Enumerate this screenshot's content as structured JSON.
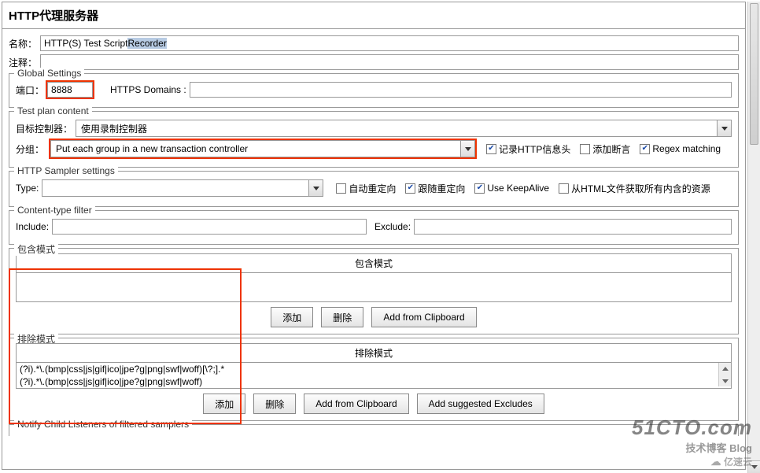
{
  "title": "HTTP代理服务器",
  "name_label": "名称：",
  "name_value": "HTTP(S) Test Script Recorder",
  "comment_label": "注释：",
  "comment_value": "",
  "global": {
    "legend": "Global Settings",
    "port_label": "端口：",
    "port_value": "8888",
    "https_label": "HTTPS Domains :",
    "https_value": ""
  },
  "plan": {
    "legend": "Test plan content",
    "target_label": "目标控制器：",
    "target_value": "使用录制控制器",
    "group_label": "分组：",
    "group_value": "Put each group in a new transaction controller",
    "cb_capture": "记录HTTP信息头",
    "cb_assert": "添加断言",
    "cb_regex": "Regex matching"
  },
  "sampler": {
    "legend": "HTTP Sampler settings",
    "type_label": "Type:",
    "type_value": "",
    "cb_auto": "自动重定向",
    "cb_follow": "跟随重定向",
    "cb_keep": "Use KeepAlive",
    "cb_html": "从HTML文件获取所有内含的资源"
  },
  "ctype": {
    "legend": "Content-type filter",
    "include_label": "Include:",
    "include_value": "",
    "exclude_label": "Exclude:",
    "exclude_value": ""
  },
  "include": {
    "legend": "包含模式",
    "header": "包含模式",
    "btn_add": "添加",
    "btn_del": "删除",
    "btn_clip": "Add from Clipboard"
  },
  "exclude": {
    "legend": "排除模式",
    "header": "排除模式",
    "rows": [
      "(?i).*\\.(bmp|css|js|gif|ico|jpe?g|png|swf|woff)[\\?;].*",
      "(?i).*\\.(bmp|css|js|gif|ico|jpe?g|png|swf|woff)"
    ],
    "btn_add": "添加",
    "btn_del": "删除",
    "btn_clip": "Add from Clipboard",
    "btn_sugg": "Add suggested Excludes"
  },
  "notify_legend": "Notify Child Listeners of filtered samplers",
  "watermark": {
    "l1": "51CTO.com",
    "l2": "技术博客         Blog",
    "l3": "亿速云"
  }
}
